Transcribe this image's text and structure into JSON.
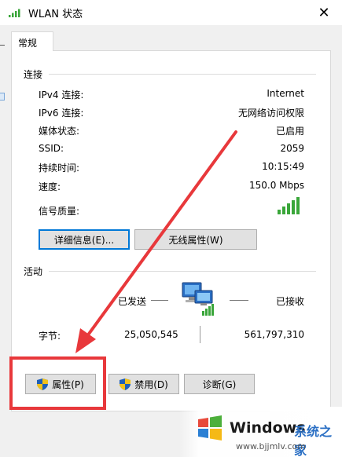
{
  "window": {
    "title": "WLAN 状态",
    "close_glyph": "✕"
  },
  "tab": {
    "label": "常规"
  },
  "connection": {
    "title": "连接",
    "rows": [
      {
        "label": "IPv4 连接:",
        "value": "Internet"
      },
      {
        "label": "IPv6 连接:",
        "value": "无网络访问权限"
      },
      {
        "label": "媒体状态:",
        "value": "已启用"
      },
      {
        "label": "SSID:",
        "value": "2059"
      },
      {
        "label": "持续时间:",
        "value": "10:15:49"
      },
      {
        "label": "速度:",
        "value": "150.0 Mbps"
      }
    ],
    "signal_label": "信号质量:",
    "signal_icon": "signal-bars-icon",
    "details_button": "详细信息(E)...",
    "wireless_props_button": "无线属性(W)"
  },
  "activity": {
    "title": "活动",
    "sent_label": "已发送",
    "received_label": "已接收",
    "bytes_label": "字节:",
    "bytes_sent": "25,050,545",
    "bytes_received": "561,797,310",
    "network_icon": "network-computers-icon"
  },
  "buttons": {
    "properties": "属性(P)",
    "disable": "禁用(D)",
    "diagnose": "诊断(G)"
  },
  "watermark": {
    "brand": "Windows",
    "cn_text": "系统之家",
    "url": "www.bjjmlv.com"
  },
  "colors": {
    "annotation": "#e8383b",
    "signal_green": "#3aa63a",
    "focus_blue": "#0078d7"
  }
}
